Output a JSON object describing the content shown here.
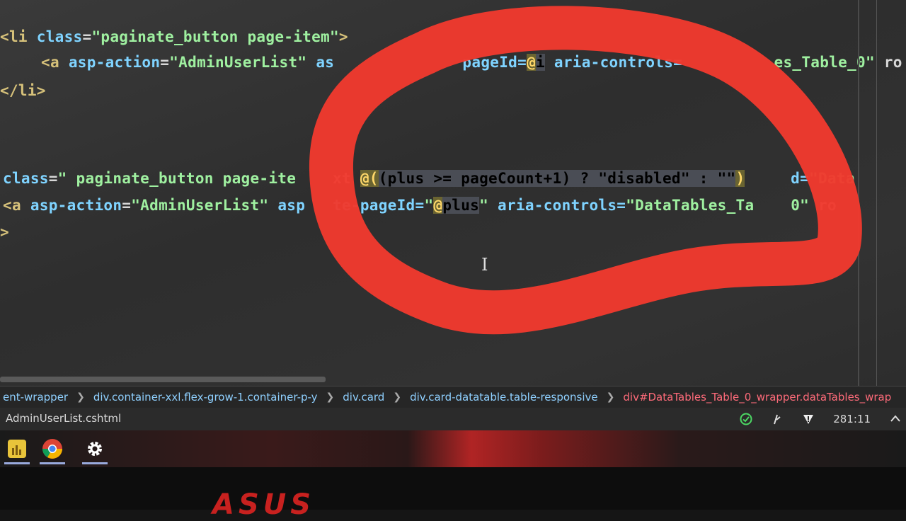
{
  "editor": {
    "lines": [
      {
        "segments": [
          {
            "t": "<li ",
            "c": "tag"
          },
          {
            "t": "class",
            "c": "attr"
          },
          {
            "t": "=",
            "c": "txt"
          },
          {
            "t": "\"paginate_button page-item\"",
            "c": "str"
          },
          {
            "t": ">",
            "c": "tag"
          }
        ]
      },
      {
        "segments": [
          {
            "t": "<a ",
            "c": "tag"
          },
          {
            "t": "asp-action",
            "c": "attr"
          },
          {
            "t": "=",
            "c": "txt"
          },
          {
            "t": "\"AdminUserList\"",
            "c": "str"
          },
          {
            "t": " as",
            "c": "attr"
          },
          {
            "t": "              pageId=",
            "c": "attr"
          },
          {
            "t": "@",
            "c": "at"
          },
          {
            "t": "i",
            "c": "sel"
          },
          {
            "t": " aria-controls=",
            "c": "attr"
          },
          {
            "t": "          es_Table_0\"",
            "c": "str"
          },
          {
            "t": " ro",
            "c": "txt"
          }
        ]
      },
      {
        "segments": [
          {
            "t": "</li>",
            "c": "tag"
          }
        ]
      },
      {
        "segments": [
          {
            "t": "class",
            "c": "attr"
          },
          {
            "t": "=",
            "c": "txt"
          },
          {
            "t": "\" paginate_button page-ite",
            "c": "str"
          },
          {
            "t": "    xt ",
            "c": "txt"
          },
          {
            "t": "@(",
            "c": "at"
          },
          {
            "t": "(plus >= pageCount+1) ? \"disabled\" : \"\"",
            "c": "sel"
          },
          {
            "t": ")",
            "c": "at"
          },
          {
            "t": "     d=",
            "c": "attr"
          },
          {
            "t": "\"Data",
            "c": "str"
          }
        ]
      },
      {
        "segments": [
          {
            "t": "<a ",
            "c": "tag"
          },
          {
            "t": "asp-action",
            "c": "attr"
          },
          {
            "t": "=",
            "c": "txt"
          },
          {
            "t": "\"AdminUserList\"",
            "c": "str"
          },
          {
            "t": " asp",
            "c": "attr"
          },
          {
            "t": "   te-pageId=",
            "c": "attr"
          },
          {
            "t": "\"",
            "c": "str"
          },
          {
            "t": "@",
            "c": "at"
          },
          {
            "t": "plus",
            "c": "sel"
          },
          {
            "t": "\"",
            "c": "str"
          },
          {
            "t": " aria-controls=",
            "c": "attr"
          },
          {
            "t": "\"DataTables_Ta    0\"",
            "c": "str"
          },
          {
            "t": " ro",
            "c": "txt"
          }
        ]
      },
      {
        "segments": [
          {
            "t": ">",
            "c": "tag"
          }
        ]
      }
    ]
  },
  "breadcrumb": {
    "items": [
      "ent-wrapper",
      "div.container-xxl.flex-grow-1.container-p-y",
      "div.card",
      "div.card-datatable.table-responsive",
      "div#DataTables_Table_0_wrapper.dataTables_wrap"
    ]
  },
  "statusbar": {
    "file_name": "AdminUserList.cshtml",
    "position": "281:11"
  },
  "taskbar": {
    "apps": [
      {
        "name": "app-launcher"
      },
      {
        "name": "chrome"
      },
      {
        "name": "settings"
      }
    ]
  },
  "monitor": {
    "brand": "ASUS"
  },
  "colors": {
    "annotation": "#f03a2e"
  }
}
